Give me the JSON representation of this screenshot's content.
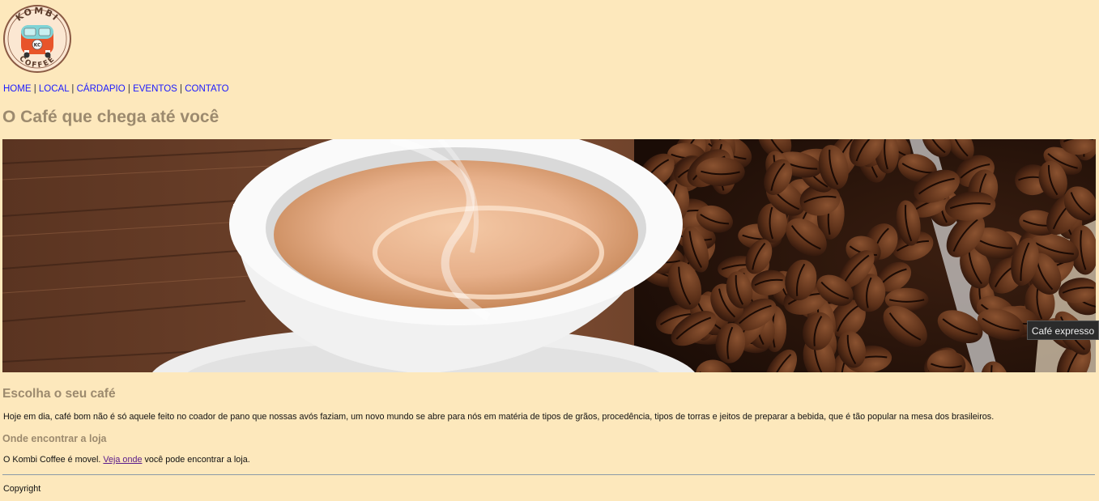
{
  "logo": {
    "top_text": "KOMBI",
    "bottom_text": "COFFEE",
    "badge": "KC"
  },
  "nav": [
    {
      "label": "HOME"
    },
    {
      "label": "LOCAL"
    },
    {
      "label": "CÁRDAPIO"
    },
    {
      "label": "EVENTOS"
    },
    {
      "label": "CONTATO"
    }
  ],
  "nav_separator": "|",
  "page_title": "O Café que chega até você",
  "hero": {
    "tooltip": "Café expresso"
  },
  "section1": {
    "heading": "Escolha o seu café",
    "text": "Hoje em dia, café bom não é só aquele feito no coador de pano que nossas avós faziam, um novo mundo se abre para nós em matéria de tipos de grãos, procedência, tipos de torras e jeitos de preparar a bebida, que é tão popular na mesa dos brasileiros."
  },
  "section2": {
    "heading": "Onde encontrar a loja",
    "text_before": "O Kombi Coffee é movel.",
    "link": "Veja onde",
    "text_after": "você pode encontrar a loja."
  },
  "footer": {
    "text": "Copyright"
  },
  "colors": {
    "background": "#fde8bc",
    "heading": "#9c8a6e",
    "link": "#1a1aff",
    "visited_link": "#5a1a8a"
  }
}
